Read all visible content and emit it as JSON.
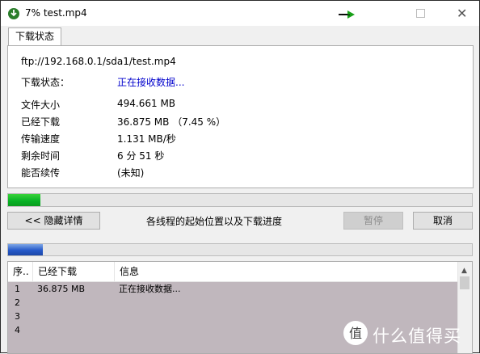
{
  "window": {
    "title": "7% test.mp4",
    "close_glyph": "✕"
  },
  "tab": {
    "label": "下载状态"
  },
  "info": {
    "url": "ftp://192.168.0.1/sda1/test.mp4",
    "status_label": "下载状态：",
    "status_value": "正在接收数据...",
    "rows": [
      {
        "label": "文件大小",
        "value": "494.661  MB"
      },
      {
        "label": "已经下载",
        "value": "36.875  MB  （7.45 %）"
      },
      {
        "label": "传输速度",
        "value": "1.131  MB/秒"
      },
      {
        "label": "剩余时间",
        "value": "6 分 51 秒"
      },
      {
        "label": "能否续传",
        "value": "(未知)"
      }
    ]
  },
  "progress": {
    "percent": 7
  },
  "controls": {
    "hide_details": "<< 隐藏详情",
    "threads_caption": "各线程的起始位置以及下载进度",
    "pause": "暂停",
    "cancel": "取消"
  },
  "thread_progress": {
    "fraction": 0.075
  },
  "table": {
    "headers": [
      "序..",
      "已经下载",
      "信息"
    ],
    "rows": [
      {
        "idx": "1",
        "downloaded": "36.875 MB",
        "info": "正在接收数据..."
      },
      {
        "idx": "2",
        "downloaded": "",
        "info": ""
      },
      {
        "idx": "3",
        "downloaded": "",
        "info": ""
      },
      {
        "idx": "4",
        "downloaded": "",
        "info": ""
      }
    ]
  },
  "scrollbar": {
    "up_glyph": "▲"
  },
  "watermark": {
    "text": "什么值得买",
    "logo_glyph": "值"
  },
  "colors": {
    "accent_link": "#0000cc",
    "progress_green": "#06b025",
    "progress_blue": "#2559c9",
    "table_bg": "#c0b7bd"
  }
}
